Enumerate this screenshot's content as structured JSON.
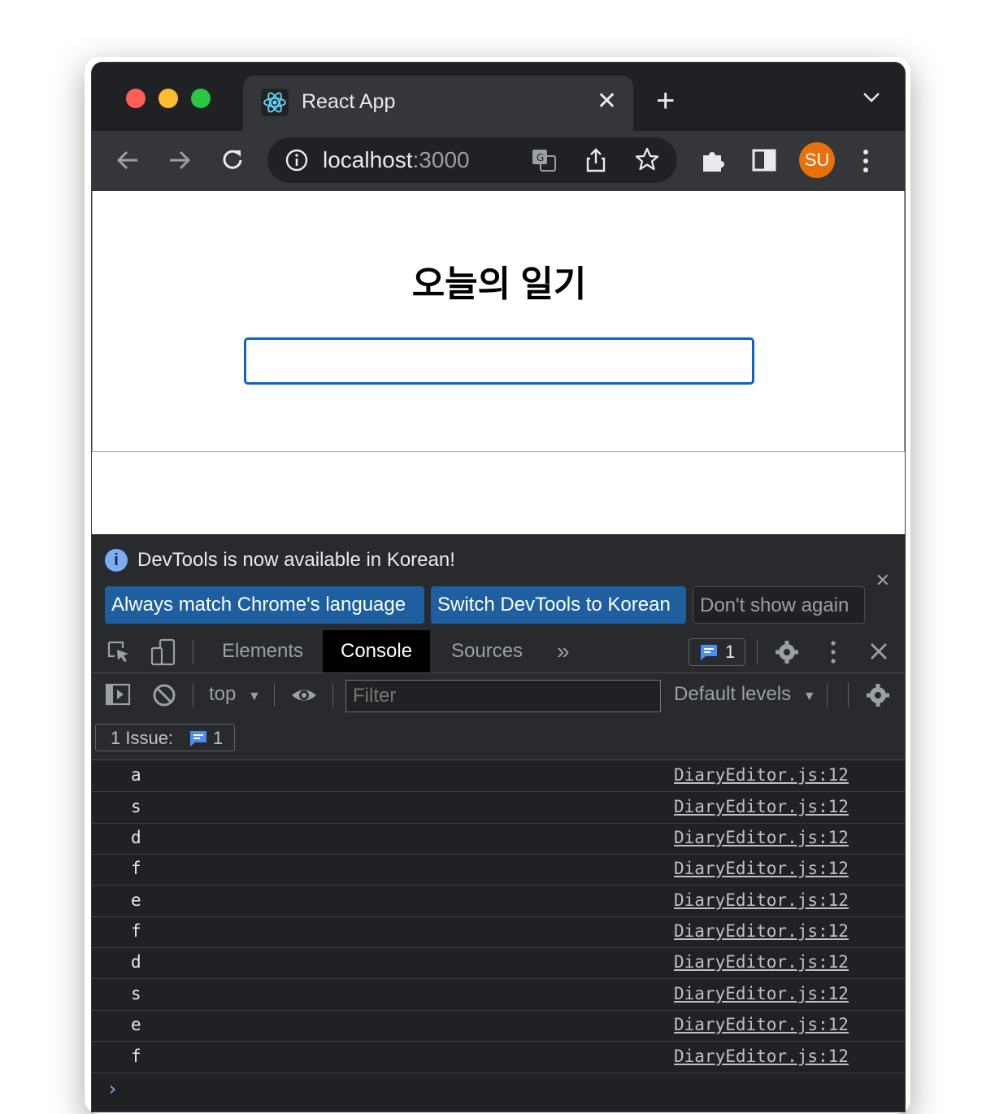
{
  "browser": {
    "tab_title": "React App",
    "tab_close": "✕",
    "new_tab": "+",
    "url_host": "localhost",
    "url_port": ":3000",
    "profile_initials": "SU",
    "profile_color": "#e8710a"
  },
  "page": {
    "heading": "오늘의 일기",
    "input_value": ""
  },
  "devtools": {
    "infobar_message": "DevTools is now available in Korean!",
    "btn_always_match": "Always match Chrome's language",
    "btn_switch": "Switch DevTools to Korean",
    "btn_dont_show": "Don't show again",
    "tabs": [
      "Elements",
      "Console",
      "Sources"
    ],
    "active_tab": "Console",
    "more_tabs": "»",
    "issues_count": "1",
    "context": "top",
    "filter_placeholder": "Filter",
    "levels": "Default levels",
    "issue_label": "1 Issue:",
    "issue_count": "1",
    "logs": [
      {
        "msg": "a",
        "src": "DiaryEditor.js:12"
      },
      {
        "msg": "s",
        "src": "DiaryEditor.js:12"
      },
      {
        "msg": "d",
        "src": "DiaryEditor.js:12"
      },
      {
        "msg": "f",
        "src": "DiaryEditor.js:12"
      },
      {
        "msg": "e",
        "src": "DiaryEditor.js:12"
      },
      {
        "msg": "f",
        "src": "DiaryEditor.js:12"
      },
      {
        "msg": "d",
        "src": "DiaryEditor.js:12"
      },
      {
        "msg": "s",
        "src": "DiaryEditor.js:12"
      },
      {
        "msg": "e",
        "src": "DiaryEditor.js:12"
      },
      {
        "msg": "f",
        "src": "DiaryEditor.js:12"
      }
    ],
    "prompt": "›"
  }
}
